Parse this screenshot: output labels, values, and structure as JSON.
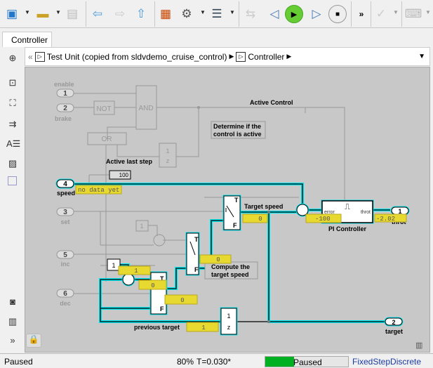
{
  "toolbar": {
    "icons": [
      "new-model-icon",
      "open-folder-icon",
      "save-icon",
      "back-arrow-icon",
      "forward-arrow-icon",
      "up-arrow-icon",
      "library-browser-icon",
      "gear-icon",
      "model-explorer-icon",
      "step-back-config-icon",
      "step-back-icon",
      "run-icon",
      "step-forward-icon",
      "stop-icon",
      "more-icon",
      "check-icon",
      "keyboard-icon"
    ],
    "more": "»"
  },
  "tab": {
    "label": "Controller"
  },
  "breadcrumb": {
    "back": "«",
    "items": [
      "Test Unit (copied from sldvdemo_cruise_control)",
      "Controller"
    ]
  },
  "diagram": {
    "inports": [
      {
        "num": "1",
        "label": "enable"
      },
      {
        "num": "2",
        "label": "brake"
      },
      {
        "num": "4",
        "label": "speed"
      },
      {
        "num": "3",
        "label": "set"
      },
      {
        "num": "5",
        "label": "inc"
      },
      {
        "num": "6",
        "label": "dec"
      }
    ],
    "outports": [
      {
        "num": "1",
        "label": "throt"
      },
      {
        "num": "2",
        "label": "target"
      }
    ],
    "blocks": {
      "not": "NOT",
      "and": "AND",
      "or": "OR",
      "delay_num": "1",
      "delay_den": "z",
      "display": "100",
      "const1": "1",
      "const2": "1",
      "pi": "PI Controller",
      "pi_in": "error",
      "pi_out": "throt",
      "pulse": "⎍",
      "t": "T",
      "f": "F"
    },
    "labels": {
      "active_control": "Active Control",
      "active_last": "Active last step",
      "target_speed": "Target speed",
      "previous_target": "previous target"
    },
    "comments": {
      "active": [
        "Determine if the",
        "control is active"
      ],
      "compute": [
        "Compute the",
        "target speed"
      ]
    },
    "values": {
      "speed": "no data yet",
      "sw1": "0",
      "pi_err": "-100",
      "throt": "-2.02",
      "sw2": "0",
      "const": "1",
      "sum": "0",
      "sw3": "0",
      "delay": "1"
    }
  },
  "status": {
    "state": "Paused",
    "zoom": "80%",
    "time": "T=0.030*",
    "progress_label": "Paused",
    "progress_percent": 35,
    "solver": "FixedStepDiscrete"
  },
  "colors": {
    "highlight": "#00e5ee",
    "value_label": "#e8d930",
    "progress": "#00b020"
  }
}
